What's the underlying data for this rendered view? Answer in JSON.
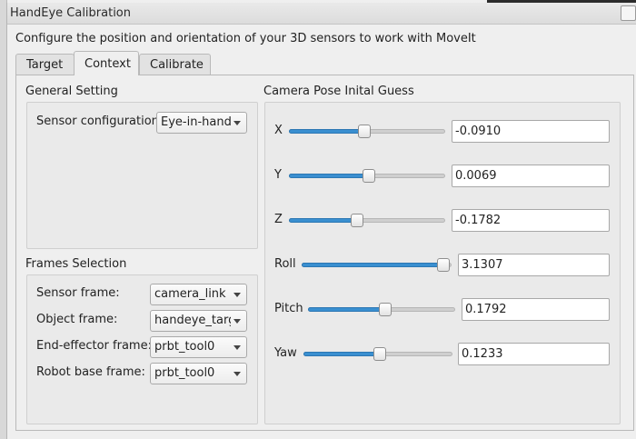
{
  "window": {
    "title": "HandEye Calibration"
  },
  "description": "Configure the position and orientation of your 3D sensors to work with MoveIt",
  "tabs": [
    {
      "label": "Target"
    },
    {
      "label": "Context",
      "active": true
    },
    {
      "label": "Calibrate"
    }
  ],
  "general": {
    "title": "General Setting",
    "sensor_config_label": "Sensor configuration",
    "sensor_config_value": "Eye-in-hand"
  },
  "frames": {
    "title": "Frames Selection",
    "rows": [
      {
        "label": "Sensor frame:",
        "value": "camera_link"
      },
      {
        "label": "Object frame:",
        "value": "handeye_targ"
      },
      {
        "label": "End-effector frame:",
        "value": "prbt_tool0"
      },
      {
        "label": "Robot base frame:",
        "value": "prbt_tool0"
      }
    ]
  },
  "pose": {
    "title": "Camera Pose Inital Guess",
    "rows": [
      {
        "label": "X",
        "value": "-0.0910",
        "slider_fraction": 0.48
      },
      {
        "label": "Y",
        "value": "0.0069",
        "slider_fraction": 0.51
      },
      {
        "label": "Z",
        "value": "-0.1782",
        "slider_fraction": 0.43
      },
      {
        "label": "Roll",
        "value": "3.1307",
        "slider_fraction": 0.99
      },
      {
        "label": "Pitch",
        "value": "0.1792",
        "slider_fraction": 0.53
      },
      {
        "label": "Yaw",
        "value": "0.1233",
        "slider_fraction": 0.51
      }
    ]
  },
  "colors": {
    "accent": "#3a8fd0",
    "background": "#efefef"
  }
}
